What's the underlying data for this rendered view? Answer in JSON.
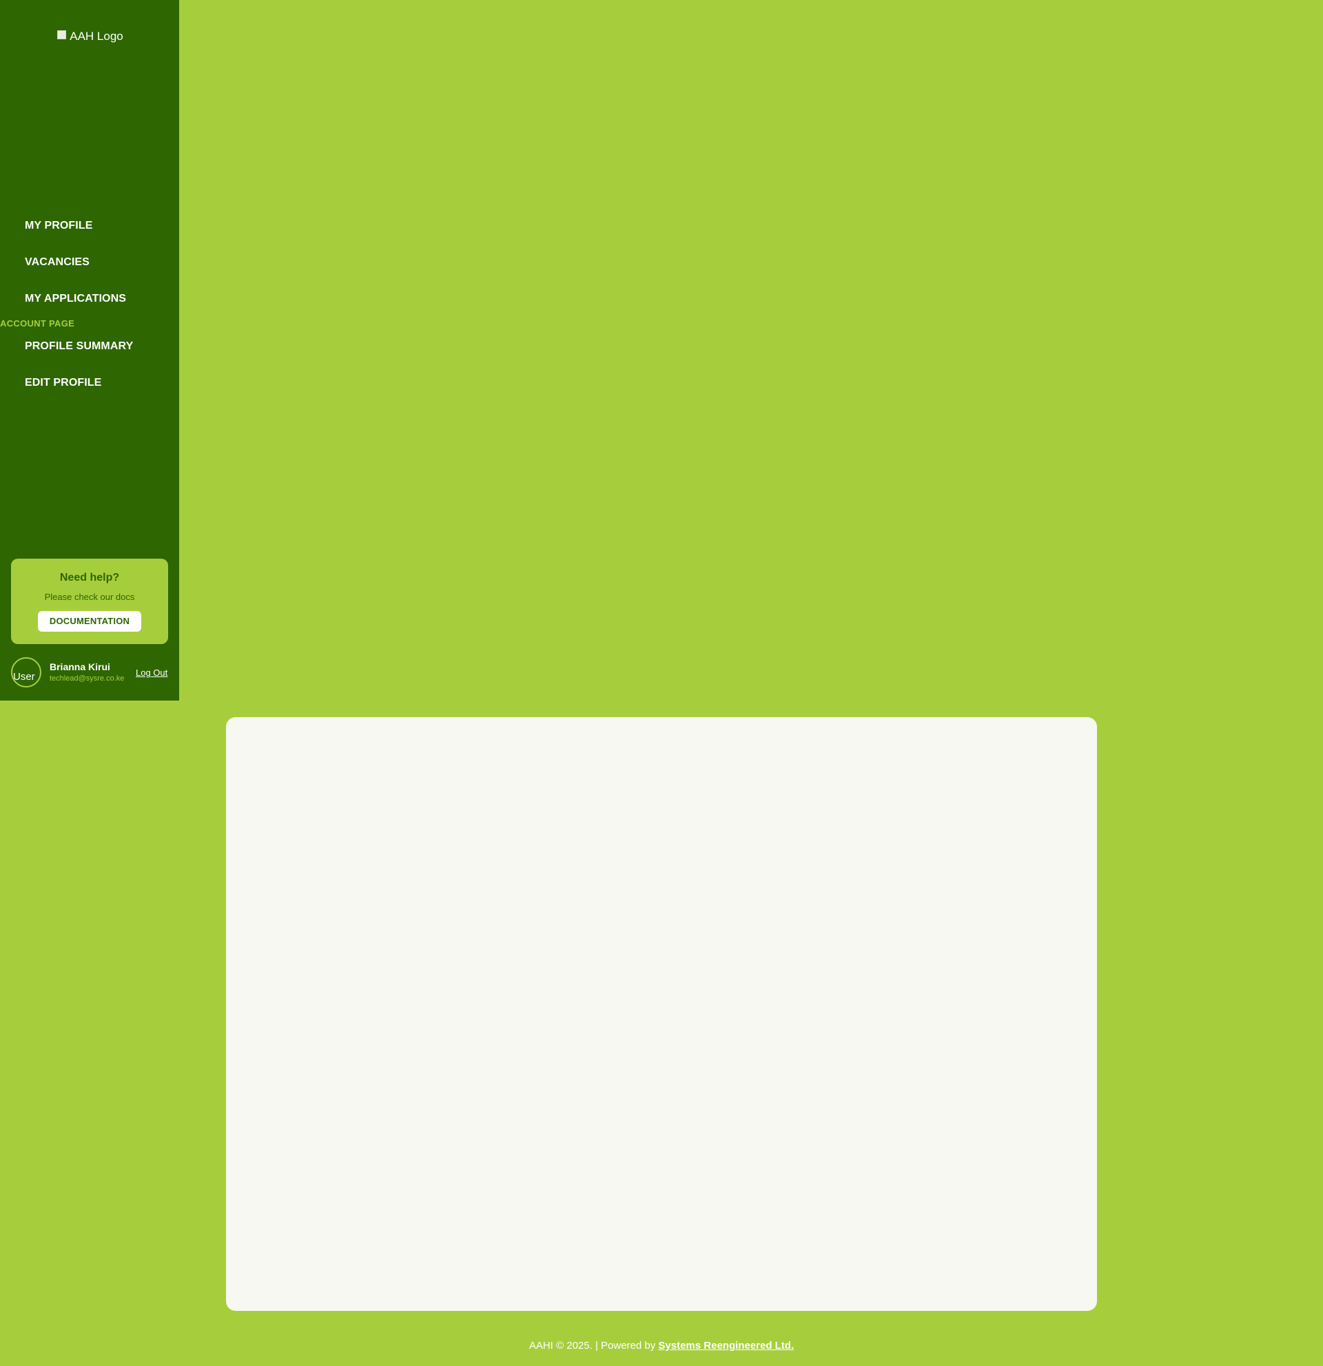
{
  "sidebar": {
    "logo_alt": "AAH Logo",
    "nav": [
      {
        "label": "MY PROFILE"
      },
      {
        "label": "VACANCIES"
      },
      {
        "label": "MY APPLICATIONS"
      }
    ],
    "section_label": "ACCOUNT PAGE",
    "account_nav": [
      {
        "label": "PROFILE SUMMARY"
      },
      {
        "label": "EDIT PROFILE"
      }
    ],
    "help": {
      "title": "Need help?",
      "subtitle": "Please check our docs",
      "button_label": "DOCUMENTATION"
    },
    "user": {
      "avatar_alt": "User",
      "name": "Brianna Kirui",
      "email": "techlead@sysre.co.ke",
      "logout_label": "Log Out"
    }
  },
  "footer": {
    "text": "AAHI © 2025. | Powered by",
    "link_label": "Systems Reengineered Ltd."
  },
  "colors": {
    "sidebar_bg": "#2e6602",
    "page_bg": "#a6ce3c",
    "card_bg": "#f6f8f1",
    "accent": "#a6ce3c"
  }
}
